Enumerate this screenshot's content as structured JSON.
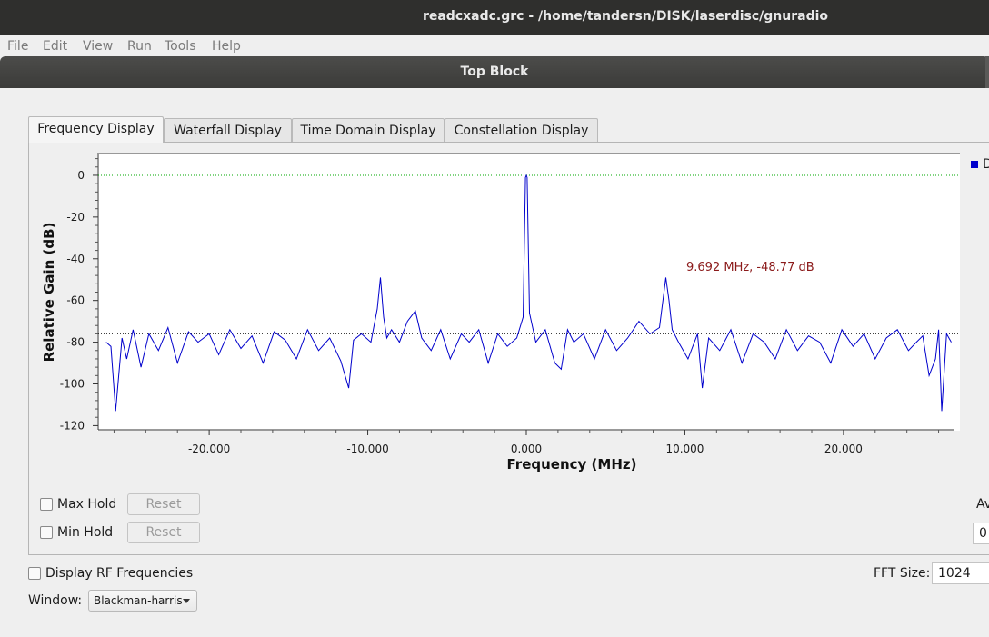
{
  "window": {
    "title": "readcxadc.grc - /home/tandersn/DISK/laserdisc/gnuradio"
  },
  "menu": [
    "File",
    "Edit",
    "View",
    "Run",
    "Tools",
    "Help"
  ],
  "top_block": {
    "title": "Top Block"
  },
  "tabs": [
    "Frequency Display",
    "Waterfall Display",
    "Time Domain Display",
    "Constellation Display"
  ],
  "active_tab": "Frequency Display",
  "legend_partial": "D",
  "controls": {
    "max_hold": "Max Hold",
    "min_hold": "Min Hold",
    "reset": "Reset",
    "avg_partial": "Av",
    "avg_value_partial": "0",
    "display_rf": "Display RF Frequencies",
    "fft_size_label": "FFT Size:",
    "fft_size_value": "1024",
    "window_label": "Window:",
    "window_value": "Blackman-harris"
  },
  "colors": {
    "trace": "#0000cc",
    "marker_text": "#8b1a1a",
    "zero_line": "#00aa00"
  },
  "chart_data": {
    "type": "line",
    "xlabel": "Frequency (MHz)",
    "ylabel": "Relative Gain (dB)",
    "xlim": [
      -27.0,
      27.0
    ],
    "ylim": [
      -122,
      10
    ],
    "x_ticks": [
      -20,
      -10,
      0,
      10,
      20
    ],
    "x_tick_labels": [
      "-20.000",
      "-10.000",
      "0.000",
      "10.000",
      "20.000"
    ],
    "y_ticks": [
      0,
      -20,
      -40,
      -60,
      -80,
      -100,
      -120
    ],
    "y_tick_labels": [
      "0",
      "-20",
      "-40",
      "-60",
      "-80",
      "-100",
      "-120"
    ],
    "marker_annotation": "9.692 MHz, -48.77 dB",
    "reference_lines": [
      0,
      -76
    ],
    "series": [
      {
        "x": [
          -26.5,
          -26.2,
          -25.9,
          -25.5,
          -25.2,
          -24.8,
          -24.3,
          -23.8,
          -23.2,
          -22.6,
          -22.0,
          -21.3,
          -20.7,
          -20.0,
          -19.4,
          -18.7,
          -18.0,
          -17.3,
          -16.6,
          -15.9,
          -15.2,
          -14.5,
          -13.8,
          -13.1,
          -12.4,
          -11.7,
          -11.2,
          -10.9,
          -10.4,
          -9.8,
          -9.4,
          -9.2,
          -9.0,
          -8.8,
          -8.5,
          -8.0,
          -7.5,
          -7.0,
          -6.6,
          -6.0,
          -5.4,
          -4.8,
          -4.1,
          -3.6,
          -3.0,
          -2.4,
          -1.8,
          -1.2,
          -0.6,
          -0.2,
          -0.05,
          0.0,
          0.05,
          0.2,
          0.6,
          1.2,
          1.8,
          2.2,
          2.6,
          3.0,
          3.6,
          4.3,
          5.0,
          5.7,
          6.4,
          7.1,
          7.8,
          8.4,
          8.8,
          9.0,
          9.2,
          9.6,
          10.2,
          10.8,
          11.1,
          11.5,
          12.2,
          12.9,
          13.6,
          14.3,
          15.0,
          15.7,
          16.4,
          17.1,
          17.8,
          18.5,
          19.2,
          19.9,
          20.6,
          21.3,
          22.0,
          22.7,
          23.4,
          24.1,
          24.6,
          25.0,
          25.4,
          25.8,
          26.0,
          26.2,
          26.5,
          26.8
        ],
        "y": [
          -80,
          -82,
          -113,
          -78,
          -88,
          -74,
          -92,
          -76,
          -84,
          -73,
          -90,
          -75,
          -80,
          -76,
          -86,
          -74,
          -83,
          -77,
          -90,
          -75,
          -79,
          -88,
          -74,
          -84,
          -78,
          -89,
          -102,
          -79,
          -76,
          -80,
          -64,
          -49,
          -68,
          -78,
          -74,
          -80,
          -70,
          -65,
          -78,
          -84,
          -74,
          -88,
          -76,
          -80,
          -74,
          -90,
          -76,
          -82,
          -78,
          -68,
          -1,
          0,
          -1,
          -66,
          -80,
          -74,
          -90,
          -93,
          -74,
          -80,
          -76,
          -88,
          -74,
          -84,
          -78,
          -70,
          -76,
          -73,
          -49,
          -60,
          -74,
          -80,
          -88,
          -76,
          -102,
          -78,
          -84,
          -74,
          -90,
          -76,
          -80,
          -88,
          -74,
          -84,
          -77,
          -80,
          -90,
          -74,
          -82,
          -76,
          -88,
          -78,
          -74,
          -84,
          -80,
          -77,
          -96,
          -88,
          -74,
          -113,
          -76,
          -80
        ]
      }
    ]
  }
}
